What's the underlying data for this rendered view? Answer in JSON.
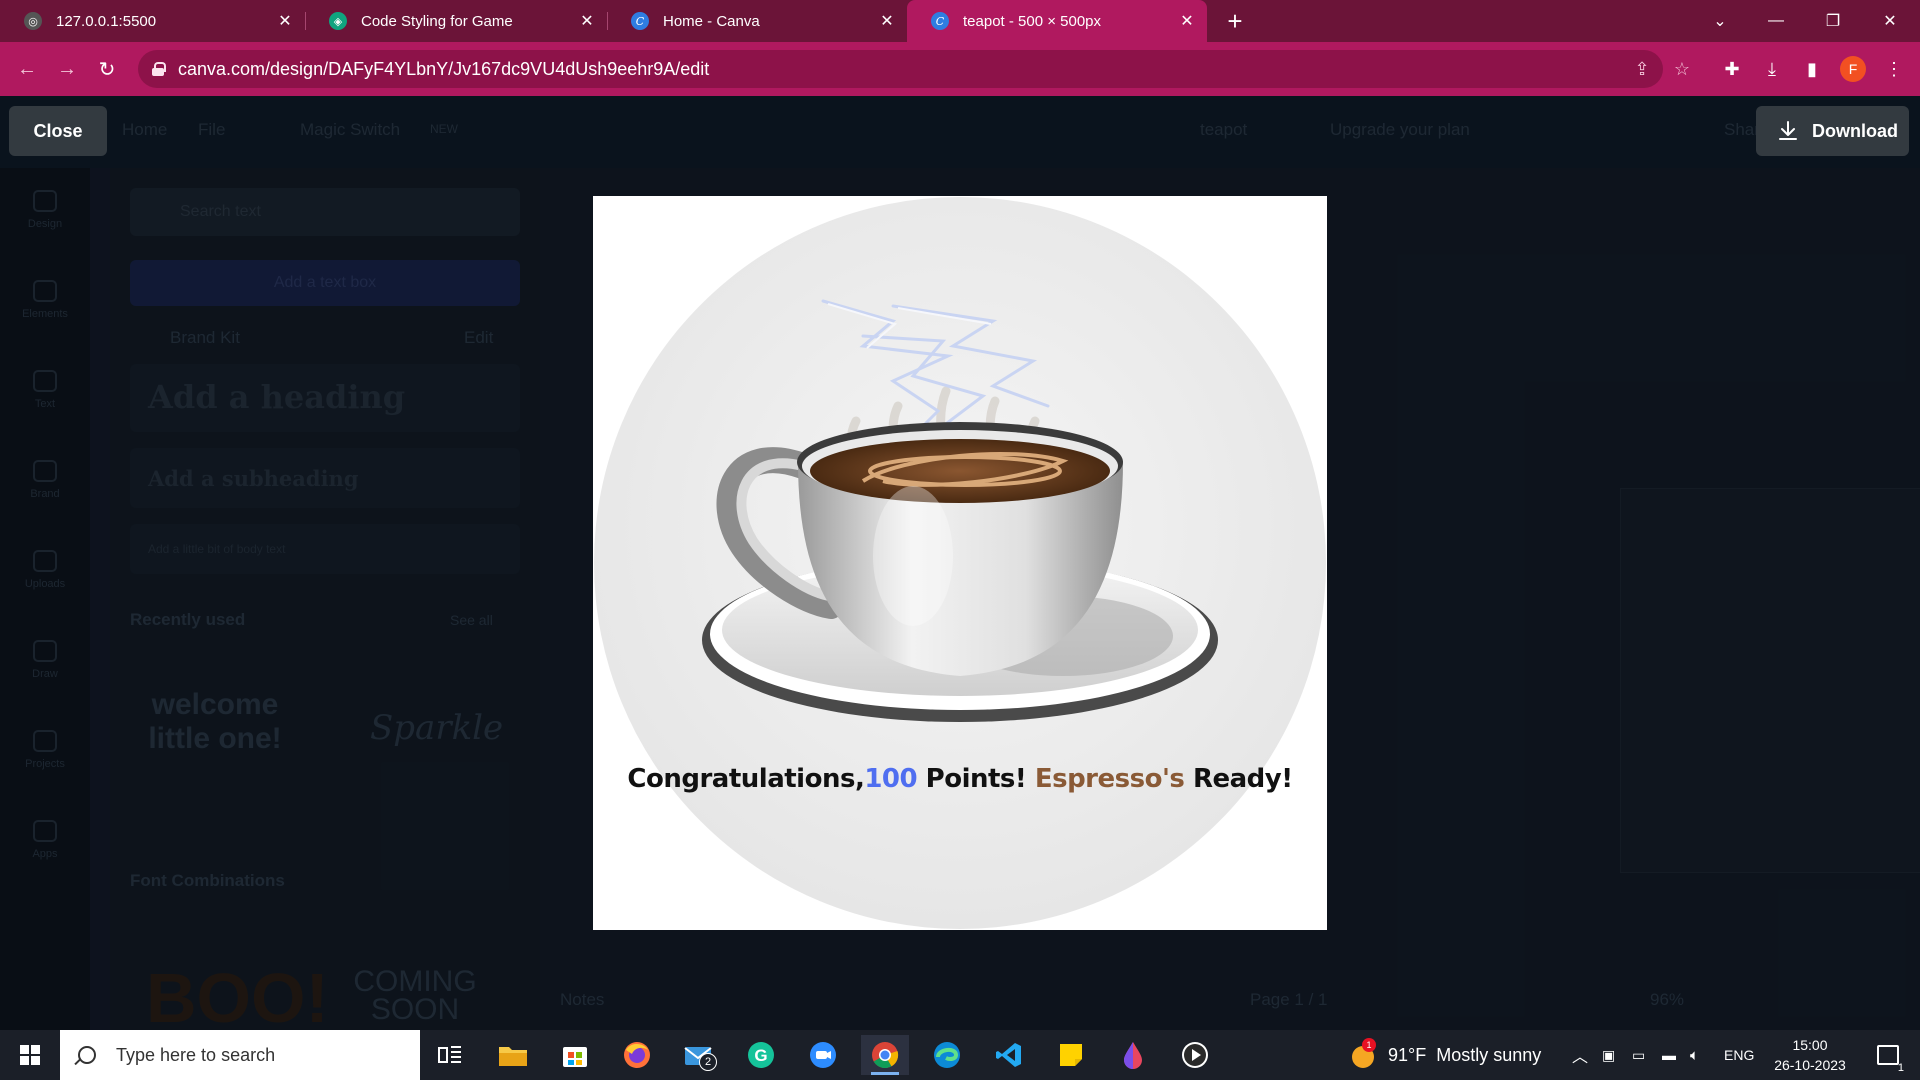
{
  "browser": {
    "tabs": [
      {
        "title": "127.0.0.1:5500",
        "icon": "globe-icon",
        "active": false
      },
      {
        "title": "Code Styling for Game",
        "icon": "chatgpt-icon",
        "active": false
      },
      {
        "title": "Home - Canva",
        "icon": "canva-icon",
        "active": false
      },
      {
        "title": "teapot - 500 × 500px",
        "icon": "canva-icon",
        "active": true
      }
    ],
    "url": "canva.com/design/DAFyF4YLbnY/Jv167dc9VU4dUsh9eehr9A/edit",
    "profile_initial": "F"
  },
  "canva_background": {
    "top_items": [
      "Home",
      "File",
      "Magic Switch",
      "NEW",
      "teapot",
      "Upgrade your plan",
      "Share"
    ],
    "sidebar": [
      "Design",
      "Elements",
      "Text",
      "Brand",
      "Uploads",
      "Draw",
      "Projects",
      "Apps"
    ],
    "panel": {
      "search_placeholder": "Search text",
      "add_textbox": "Add a text box",
      "brand_kit": "Brand Kit",
      "edit": "Edit",
      "heading": "Add a heading",
      "subheading": "Add a subheading",
      "body": "Add a little bit of body text",
      "recently_used": "Recently used",
      "see_all": "See all",
      "thumb1": "welcome little one!",
      "thumb2": "Sparkle",
      "font_combinations": "Font Combinations",
      "combo1": "BOO!",
      "combo2": "COMING SOON"
    },
    "footer": {
      "notes": "Notes",
      "page": "Page 1 / 1",
      "zoom": "96%"
    }
  },
  "modal": {
    "close_label": "Close",
    "download_label": "Download",
    "caption": {
      "part1": "Congratulations,",
      "number": "100",
      "part2": " Points! ",
      "brand": "Espresso's",
      "part3": " Ready!"
    }
  },
  "taskbar": {
    "search_placeholder": "Type here to search",
    "mail_badge": "2",
    "weather": "91°F  Mostly sunny",
    "weather_badge": "1",
    "language": "ENG",
    "time": "15:00",
    "date": "26-10-2023",
    "notifications": "1"
  },
  "colors": {
    "tab_strip": "#6b1438",
    "active_tab": "#b0195f",
    "caption_number": "#4f6ef0",
    "caption_brand": "#8a5a36"
  }
}
